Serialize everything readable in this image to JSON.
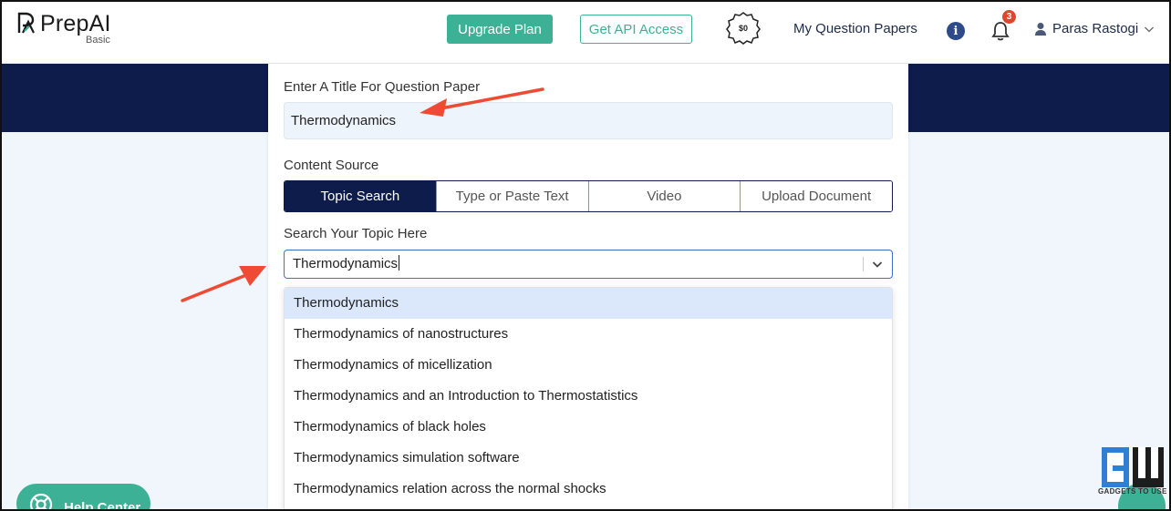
{
  "header": {
    "logo_text": "PrepAI",
    "logo_sub": "Basic",
    "upgrade_label": "Upgrade Plan",
    "api_label": "Get API Access",
    "coin_label": "$0",
    "nav_link": "My Question Papers",
    "info_icon": "i",
    "notification_count": "3",
    "user_name": "Paras Rastogi"
  },
  "form": {
    "title_label": "Enter A Title For Question Paper",
    "title_value": "Thermodynamics",
    "source_label": "Content Source",
    "tabs": [
      {
        "label": "Topic Search",
        "active": true
      },
      {
        "label": "Type or Paste Text",
        "active": false
      },
      {
        "label": "Video",
        "active": false
      },
      {
        "label": "Upload Document",
        "active": false
      }
    ],
    "search_label": "Search Your Topic Here",
    "search_value": "Thermodynamics"
  },
  "dropdown": {
    "options": [
      "Thermodynamics",
      "Thermodynamics of nanostructures",
      "Thermodynamics of micellization",
      "Thermodynamics and an Introduction to Thermostatistics",
      "Thermodynamics of black holes",
      "Thermodynamics simulation software",
      "Thermodynamics relation across the normal shocks"
    ],
    "highlighted_index": 0
  },
  "help": {
    "label": "Help Center"
  },
  "watermark": {
    "text": "GADGETS TO USE"
  },
  "colors": {
    "brand_green": "#3cb195",
    "navy": "#0d1c4a",
    "annotation_arrow": "#ee4a34"
  }
}
